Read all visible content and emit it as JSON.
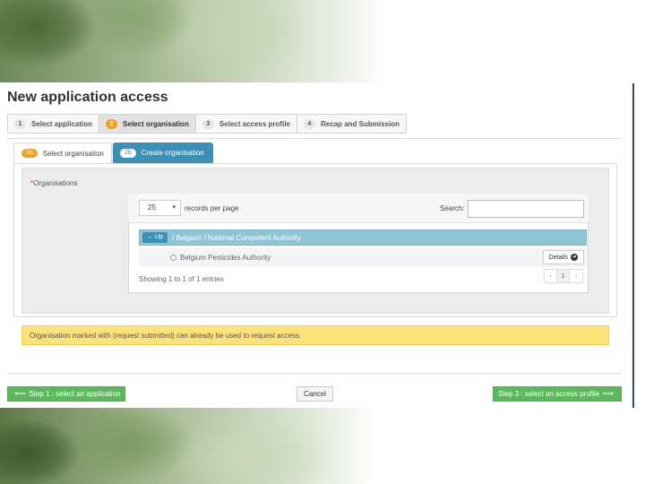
{
  "page": {
    "title": "New application access"
  },
  "wizard": {
    "steps": [
      {
        "num": "1",
        "label": "Select application",
        "active": false
      },
      {
        "num": "2",
        "label": "Select organisation",
        "active": true
      },
      {
        "num": "3",
        "label": "Select access profile",
        "active": false
      },
      {
        "num": "4",
        "label": "Recap and Submission",
        "active": false
      }
    ]
  },
  "tabs": [
    {
      "badge": "2a",
      "label": "Select organisation",
      "active": true
    },
    {
      "badge": "2b",
      "label": "Create organisation",
      "active": false
    }
  ],
  "organisations": {
    "required_mark": "*",
    "label": "Organisations",
    "per_page_value": "25",
    "per_page_caret": "▾",
    "per_page_text": "records per page",
    "search_label": "Search:",
    "search_value": "",
    "up_label": "← Up",
    "breadcrumb": "/ Belgium / National Competent Authority",
    "rows": [
      {
        "name": "Belgium Pesticides Authority",
        "action": "Details",
        "action_icon": "➔"
      }
    ],
    "showing": "Showing 1 to 1 of 1 entries",
    "pager": [
      "‹",
      "1",
      "›"
    ]
  },
  "notice": "Organisation marked with (request submitted) can already be used to request access.",
  "footer": {
    "prev_label": "Step 1 : select an application",
    "prev_arrow": "⟵",
    "cancel_label": "Cancel",
    "next_label": "Step 3 : select an access profile",
    "next_arrow": "⟶"
  },
  "colors": {
    "accent_orange": "#f0a030",
    "tab_blue": "#3a90b5",
    "breadcrumb_blue": "#8fc4d7",
    "notice_yellow": "#fde27a",
    "button_green": "#5cb85c"
  }
}
